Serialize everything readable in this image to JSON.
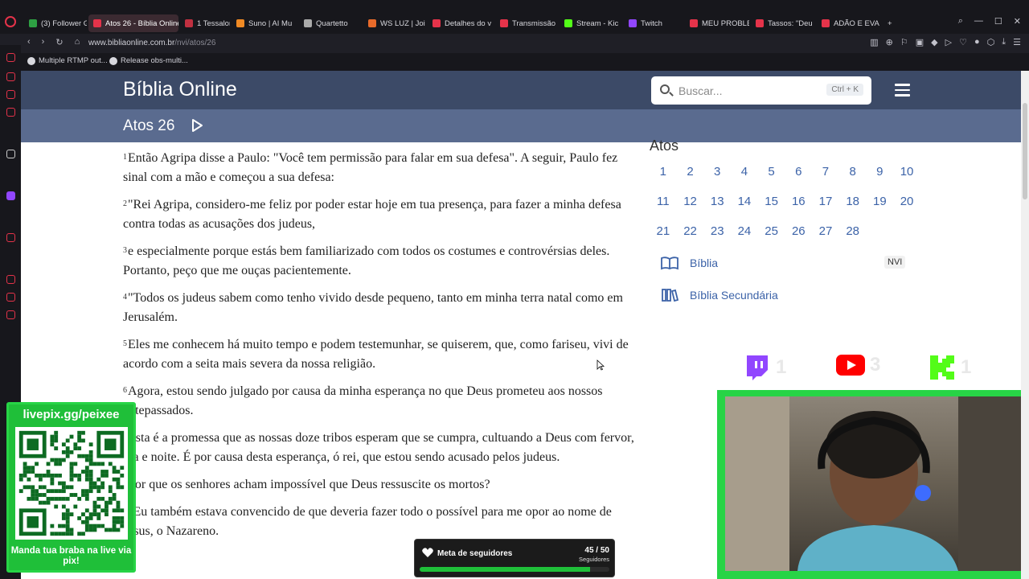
{
  "browser": {
    "tabs": [
      {
        "label": "(3) Follower G",
        "color": "#2ea043"
      },
      {
        "label": "Atos 26 - Bíblia Online",
        "color": "#e5334a",
        "active": true
      },
      {
        "label": "1 Tessalonic",
        "color": "#c03040"
      },
      {
        "label": "Suno | AI Mu",
        "color": "#f08a24"
      },
      {
        "label": "Quartetto",
        "color": "#aaaaaa"
      },
      {
        "label": "WS LUZ | Joi",
        "color": "#e86a2a"
      },
      {
        "label": "Detalhes do v",
        "color": "#e5334a"
      },
      {
        "label": "Transmissão",
        "color": "#e5334a"
      },
      {
        "label": "Stream - Kic",
        "color": "#53fc18"
      },
      {
        "label": "Twitch",
        "color": "#9146ff"
      },
      {
        "label": "MEU PROBLE",
        "color": "#e5334a"
      },
      {
        "label": "Tassos: \"Deu",
        "color": "#e5334a"
      },
      {
        "label": "ADÃO E EVA",
        "color": "#e5334a"
      }
    ],
    "url_host": "www.bibliaonline.com.br",
    "url_path": "/nvi/atos/26",
    "bookmarks": [
      {
        "label": "Multiple RTMP out..."
      },
      {
        "label": "Release obs-multi..."
      }
    ]
  },
  "site": {
    "title": "Bíblia Online",
    "search_placeholder": "Buscar...",
    "search_shortcut": "Ctrl + K",
    "chapter_title": "Atos 26"
  },
  "verses": [
    {
      "n": "1",
      "text": "Então Agripa disse a Paulo: \"Você tem permissão para falar em sua defesa\". A seguir, Paulo fez sinal com a mão e começou a sua defesa:"
    },
    {
      "n": "2",
      "text": "\"Rei Agripa, considero-me feliz por poder estar hoje em tua presença, para fazer a minha defesa contra todas as acusações dos judeus,"
    },
    {
      "n": "3",
      "text": "e especialmente porque estás bem familiarizado com todos os costumes e controvérsias deles. Portanto, peço que me ouças pacientemente."
    },
    {
      "n": "4",
      "text": "\"Todos os judeus sabem como tenho vivido desde pequeno, tanto em minha terra natal como em Jerusalém."
    },
    {
      "n": "5",
      "text": "Eles me conhecem há muito tempo e podem testemunhar, se quiserem, que, como fariseu, vivi de acordo com a seita mais severa da nossa religião."
    },
    {
      "n": "6",
      "text": "Agora, estou sendo julgado por causa da minha esperança no que Deus prometeu aos nossos antepassados."
    },
    {
      "n": "7",
      "text": "Esta é a promessa que as nossas doze tribos esperam que se cumpra, cultuando a Deus com fervor, dia e noite. É por causa desta esperança, ó rei, que estou sendo acusado pelos judeus."
    },
    {
      "n": "8",
      "text": "Por que os senhores acham impossível que Deus ressuscite os mortos?"
    },
    {
      "n": "9",
      "text": "\"Eu também estava convencido de que deveria fazer todo o possível para me opor ao nome de Jesus, o Nazareno."
    }
  ],
  "book_nav": {
    "book": "Atos",
    "chapters": [
      "1",
      "2",
      "3",
      "4",
      "5",
      "6",
      "7",
      "8",
      "9",
      "10",
      "11",
      "12",
      "13",
      "14",
      "15",
      "16",
      "17",
      "18",
      "19",
      "20",
      "21",
      "22",
      "23",
      "24",
      "25",
      "26",
      "27",
      "28"
    ],
    "bible_link": "Bíblia",
    "bible_version": "NVI",
    "secondary_link": "Bíblia Secundária"
  },
  "overlay": {
    "twitch_count": "1",
    "youtube_count": "3",
    "kick_count": "1",
    "qr_title": "livepix.gg/peixee",
    "qr_caption": "Manda tua braba na live via pix!",
    "goal_label": "Meta de seguidores",
    "goal_count": "45 / 50",
    "goal_unit": "Seguidores",
    "goal_progress": 0.9
  },
  "colors": {
    "header": "#3c4a67",
    "subheader": "#5a6b8f",
    "link": "#3c63a8",
    "overlay_green": "#1fbf39"
  }
}
